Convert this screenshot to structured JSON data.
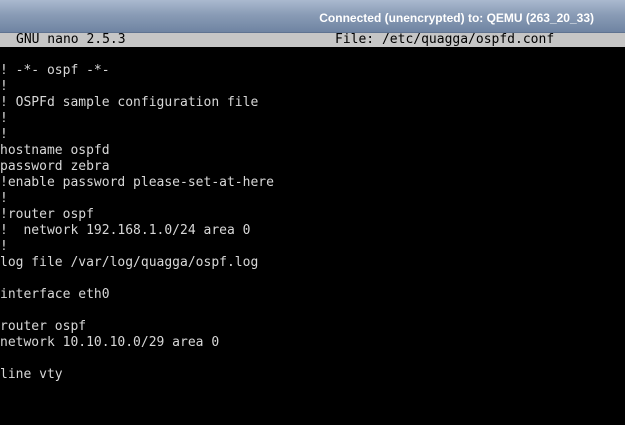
{
  "vnc": {
    "status": "Connected (unencrypted) to: QEMU (263_20_33)"
  },
  "nano": {
    "version": "GNU nano 2.5.3",
    "file_label": "File: /etc/quagga/ospfd.conf"
  },
  "lines": [
    "! -*- ospf -*-",
    "!",
    "! OSPFd sample configuration file",
    "!",
    "!",
    "hostname ospfd",
    "password zebra",
    "!enable password please-set-at-here",
    "!",
    "!router ospf",
    "!  network 192.168.1.0/24 area 0",
    "!",
    "log file /var/log/quagga/ospf.log",
    "",
    "interface eth0",
    "",
    "router ospf",
    "network 10.10.10.0/29 area 0",
    "",
    "line vty"
  ]
}
